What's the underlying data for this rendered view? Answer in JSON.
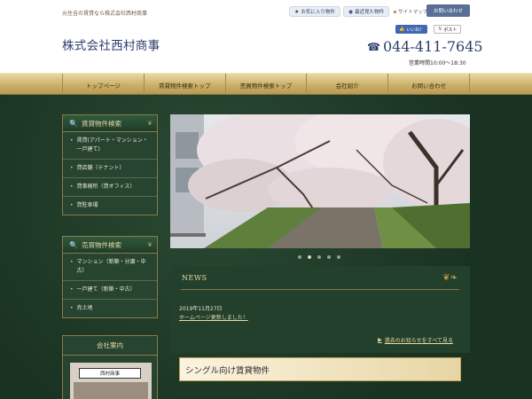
{
  "header": {
    "tagline": "元住吉の賃貸なら株式会社西村商事",
    "company_name": "株式会社西村商事",
    "links": [
      {
        "icon": "star-icon",
        "label": "お気に入り物件"
      },
      {
        "icon": "eye-icon",
        "label": "最近見た物件"
      }
    ],
    "sitemap_label": "サイトマップ",
    "contact_label": "お問い合わせ",
    "fb_label": "いいね！",
    "tw_label": "ポスト",
    "phone": "044-411-7645",
    "hours": "営業時間10:00～18:30"
  },
  "nav": {
    "items": [
      "トップページ",
      "賃貸物件検索トップ",
      "売買物件検索トップ",
      "会社紹介",
      "お問い合わせ"
    ]
  },
  "sidebar": {
    "rental": {
      "title": "賃貸物件検索",
      "items": [
        "賃貸(アパート・マンション・一戸建て)",
        "貸店舗（テナント）",
        "貸事務所（貸オフィス）",
        "貸駐車場"
      ]
    },
    "sale": {
      "title": "売買物件検索",
      "items": [
        "マンション（新築・分譲・中古）",
        "一戸建て（新築・中古）",
        "売土地"
      ]
    },
    "company": {
      "title": "会社案内",
      "sign_text": "西村商事"
    }
  },
  "slideshow": {
    "count": 5,
    "active": 1
  },
  "news": {
    "title": "NEWS",
    "items": [
      {
        "date": "2019年11月27日",
        "text": "ホームページ更新しました！"
      }
    ],
    "all_link": "過去のお知らせをすべて見る"
  },
  "section": {
    "single_title": "シングル向け賃貸物件"
  },
  "colors": {
    "navy": "#2b3d6b",
    "gold": "#c9ad66",
    "green": "#1f3a28"
  }
}
